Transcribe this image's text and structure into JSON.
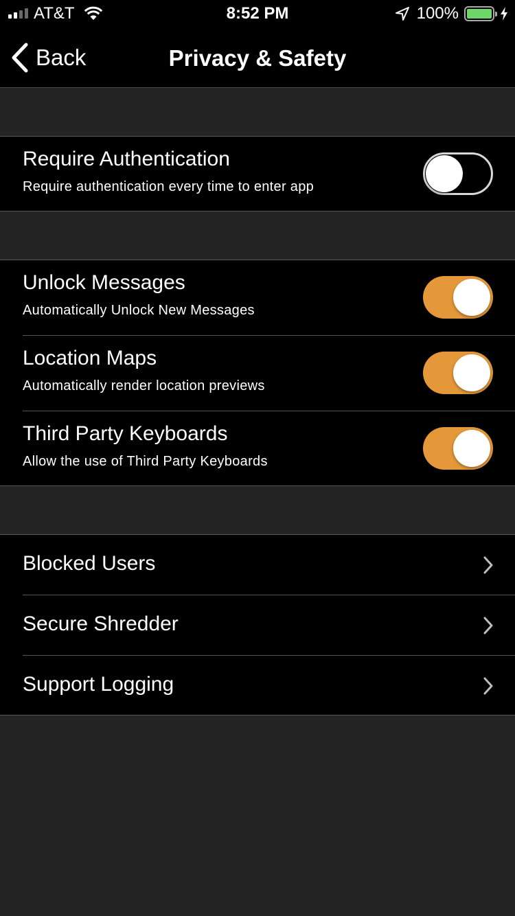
{
  "status_bar": {
    "carrier": "AT&T",
    "time": "8:52 PM",
    "battery_percent": "100%",
    "signal_bars_filled": 2,
    "signal_bars_total": 4,
    "icons": [
      "signal-icon",
      "wifi-icon",
      "location-arrow-icon",
      "battery-icon",
      "charging-bolt-icon"
    ]
  },
  "nav": {
    "back_label": "Back",
    "title": "Privacy & Safety"
  },
  "sections": [
    {
      "rows": [
        {
          "title": "Require Authentication",
          "subtitle": "Require authentication every time to enter app",
          "toggle": false
        }
      ]
    },
    {
      "rows": [
        {
          "title": "Unlock Messages",
          "subtitle": "Automatically Unlock New Messages",
          "toggle": true
        },
        {
          "title": "Location Maps",
          "subtitle": "Automatically render location previews",
          "toggle": true
        },
        {
          "title": "Third Party Keyboards",
          "subtitle": "Allow the use of Third Party Keyboards",
          "toggle": true
        }
      ]
    },
    {
      "rows": [
        {
          "title": "Blocked Users",
          "chevron": true
        },
        {
          "title": "Secure Shredder",
          "chevron": true
        },
        {
          "title": "Support Logging",
          "chevron": true
        }
      ]
    }
  ],
  "colors": {
    "accent": "#e4983a",
    "background": "#242424",
    "cell_background": "#000000",
    "battery_green": "#6fd66a"
  }
}
